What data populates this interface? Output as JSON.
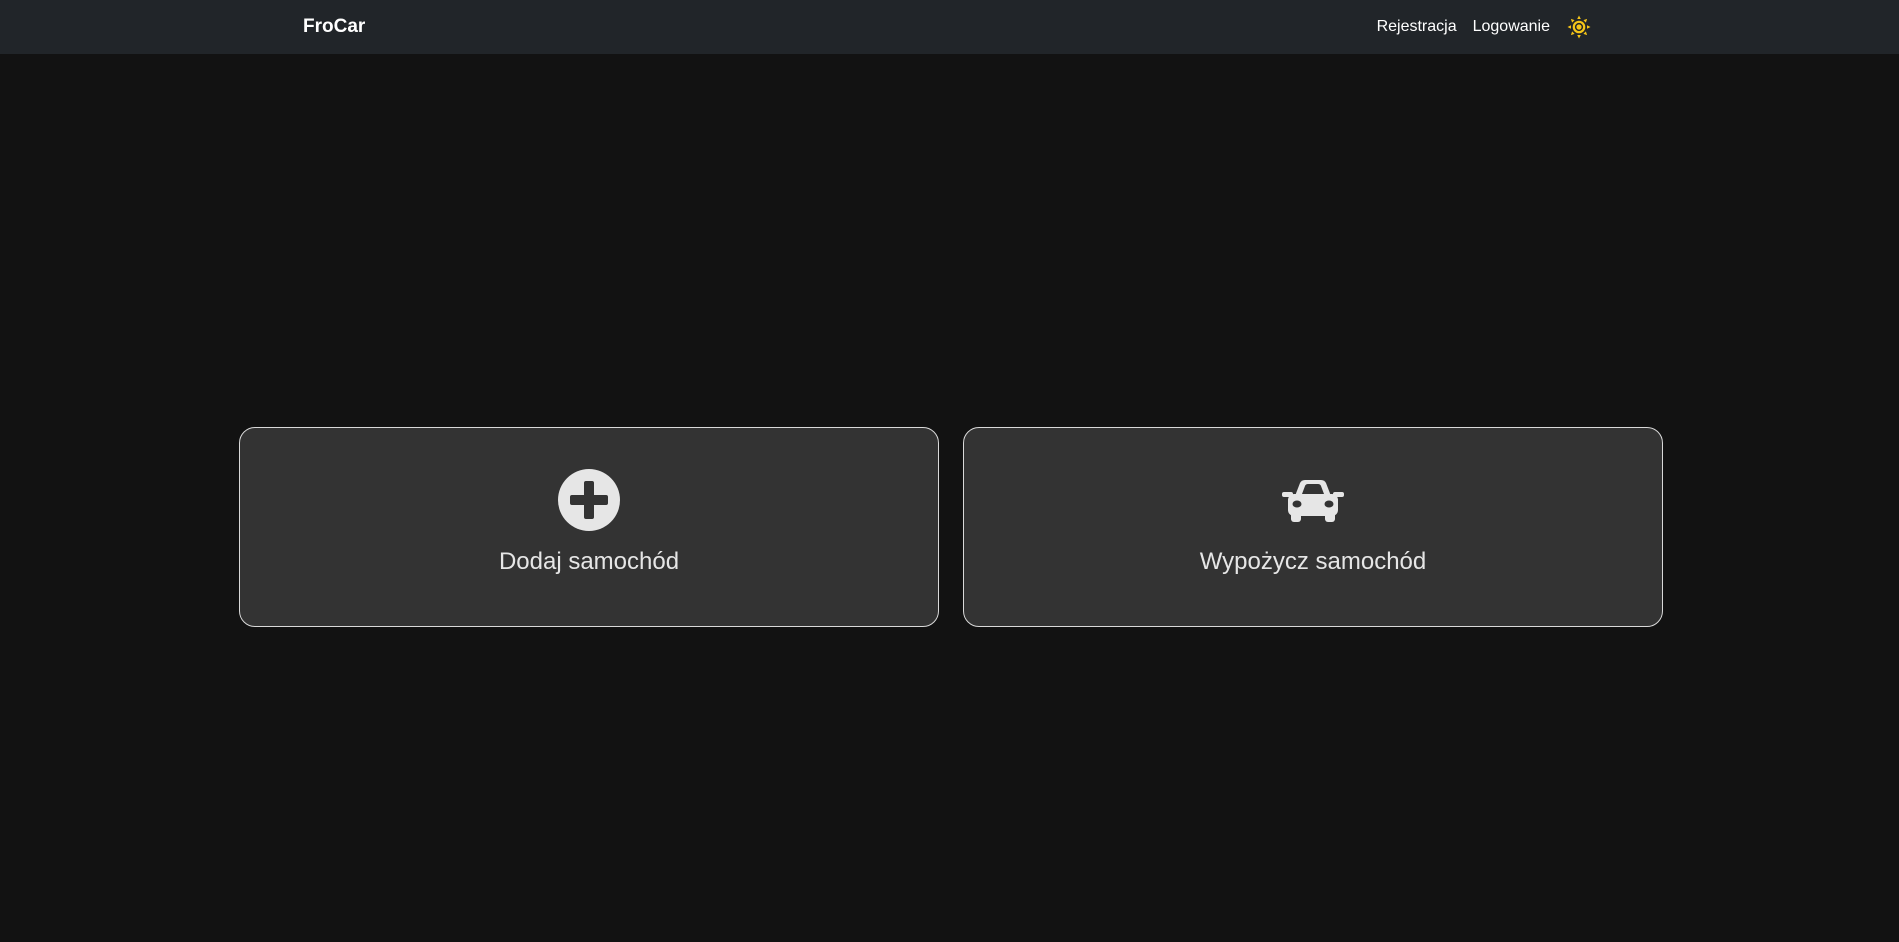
{
  "navbar": {
    "brand": "FroCar",
    "links": [
      {
        "label": "Rejestracja"
      },
      {
        "label": "Logowanie"
      }
    ],
    "theme_icon": "sun-icon",
    "theme_icon_color": "#f5c518"
  },
  "cards": [
    {
      "label": "Dodaj samochód",
      "icon": "plus-circle-icon"
    },
    {
      "label": "Wypożycz samochód",
      "icon": "car-icon"
    }
  ],
  "colors": {
    "background": "#121212",
    "navbar": "#212529",
    "card_background": "#333333",
    "card_border": "#d9d9d9",
    "icon": "#e6e6e6"
  }
}
